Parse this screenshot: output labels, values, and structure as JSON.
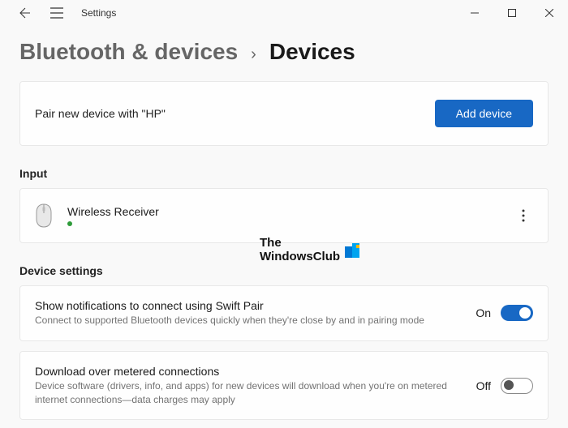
{
  "titlebar": {
    "app_title": "Settings"
  },
  "breadcrumb": {
    "parent": "Bluetooth & devices",
    "separator": "›",
    "current": "Devices"
  },
  "pair_card": {
    "text": "Pair new device with \"HP\"",
    "button": "Add device"
  },
  "sections": {
    "input_label": "Input",
    "device_settings_label": "Device settings"
  },
  "input_device": {
    "name": "Wireless Receiver"
  },
  "settings": {
    "swift_pair": {
      "title": "Show notifications to connect using Swift Pair",
      "desc": "Connect to supported Bluetooth devices quickly when they're close by and in pairing mode",
      "state_label": "On",
      "on": true
    },
    "metered": {
      "title": "Download over metered connections",
      "desc": "Device software (drivers, info, and apps) for new devices will download when you're on metered internet connections—data charges may apply",
      "state_label": "Off",
      "on": false
    }
  },
  "watermark": {
    "line1": "The",
    "line2": "WindowsClub"
  }
}
